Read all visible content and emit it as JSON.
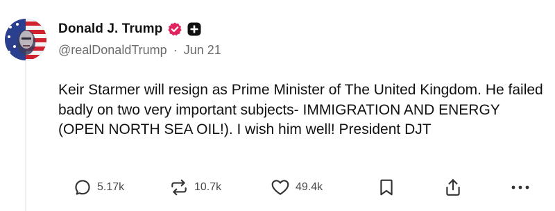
{
  "author": {
    "display_name": "Donald J. Trump",
    "handle": "@realDonaldTrump",
    "separator": "·",
    "date": "Jun 21",
    "verified_color": "#e0245e"
  },
  "post": {
    "text": "Keir Starmer will resign as Prime Minister of The United Kingdom. He failed badly on two very important subjects- IMMIGRATION AND ENERGY (OPEN NORTH SEA OIL!). I wish him well! President DJT"
  },
  "actions": {
    "replies": "5.17k",
    "reposts": "10.7k",
    "likes": "49.4k"
  },
  "icons": {
    "reply": "reply-icon",
    "repost": "repost-icon",
    "like": "heart-icon",
    "bookmark": "bookmark-icon",
    "share": "share-icon",
    "more": "more-icon",
    "verified": "verified-badge-icon",
    "plus": "plus-badge-icon"
  }
}
